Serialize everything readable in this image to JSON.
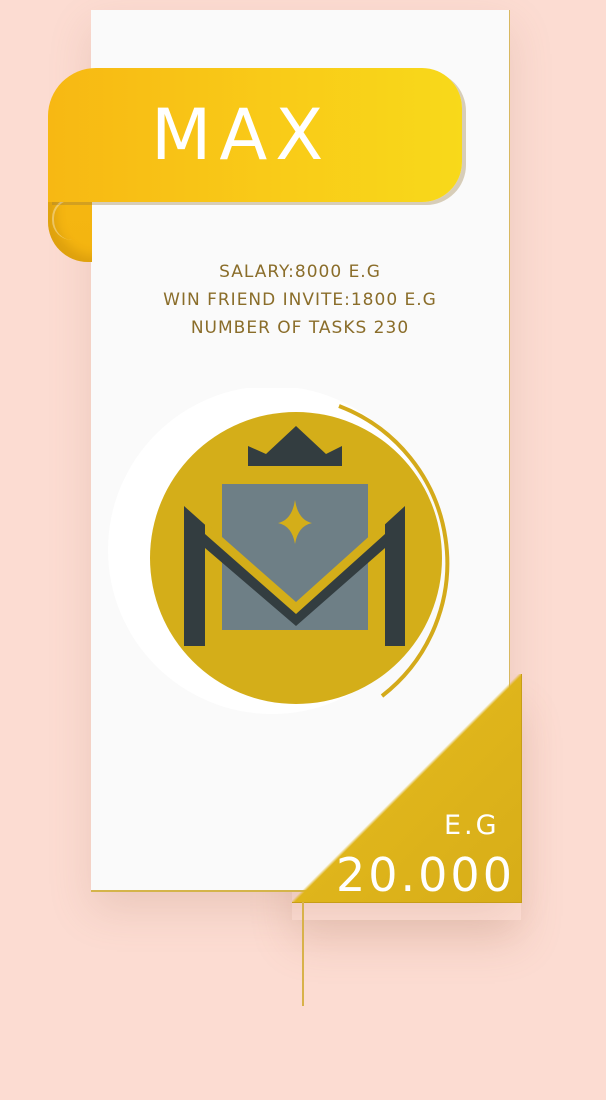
{
  "plan": {
    "name": "MAX",
    "details": [
      "SALARY:8000 E.G",
      "WIN FRIEND INVITE:1800 E.G",
      "NUMBER OF TASKS 230"
    ],
    "price": {
      "currency": "E.G",
      "value": "20.000"
    },
    "emblem_icon": "crowned-m-badge-icon"
  },
  "colors": {
    "background": "#fcdcd2",
    "card": "#fafafa",
    "ribbon": "#f8c414",
    "gold": "#d4aa1a",
    "text": "#8a6d2a",
    "emblem_gray": "#6e7f86",
    "emblem_dark": "#333d40"
  }
}
